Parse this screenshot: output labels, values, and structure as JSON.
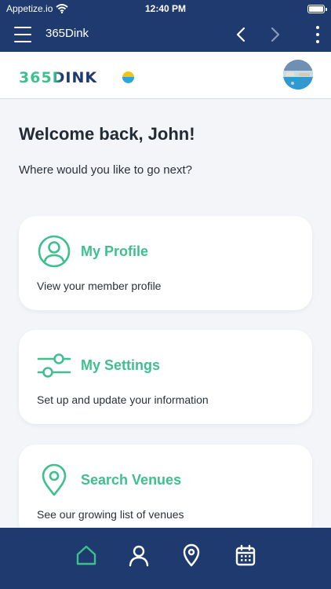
{
  "status_bar": {
    "carrier": "Appetize.io",
    "time": "12:40 PM",
    "wifi_icon": "wifi-icon",
    "battery_icon": "battery-icon"
  },
  "app_bar": {
    "title": "365Dink",
    "menu_icon": "hamburger-menu-icon",
    "back_icon": "chevron-left-icon",
    "forward_icon": "chevron-right-icon",
    "more_icon": "vertical-dots-icon"
  },
  "header": {
    "logo_text": "365DINK",
    "avatar_icon": "avatar"
  },
  "welcome": {
    "heading": "Welcome back, John!",
    "subtitle": "Where would you like to go next?"
  },
  "cards": [
    {
      "icon": "user-circle-icon",
      "title": "My Profile",
      "description": "View your member profile"
    },
    {
      "icon": "sliders-icon",
      "title": "My Settings",
      "description": "Set up and update your information"
    },
    {
      "icon": "map-pin-icon",
      "title": "Search Venues",
      "description": "See our growing list of venues"
    }
  ],
  "bottom_nav": [
    {
      "icon": "home-icon",
      "active": true
    },
    {
      "icon": "user-icon",
      "active": false
    },
    {
      "icon": "map-pin-icon",
      "active": false
    },
    {
      "icon": "calendar-icon",
      "active": false
    }
  ],
  "colors": {
    "navy": "#1e3a6e",
    "accent_green": "#3fbf8e",
    "background": "#f3f5f9",
    "text_dark": "#222a33"
  }
}
